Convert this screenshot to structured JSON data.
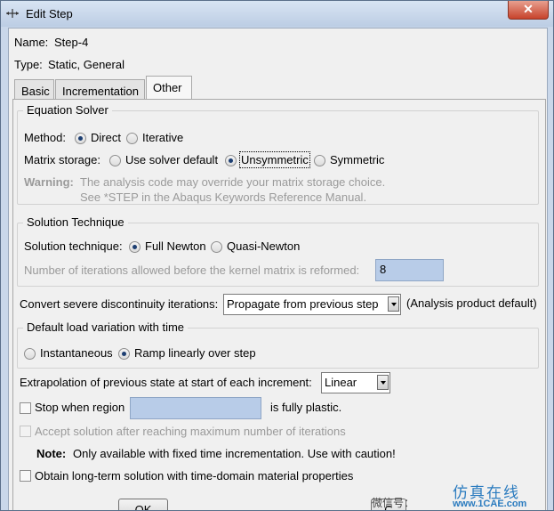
{
  "window": {
    "title": "Edit Step",
    "close_label": "✕"
  },
  "header": {
    "name_label": "Name:",
    "name_value": "Step-4",
    "type_label": "Type:",
    "type_value": "Static, General"
  },
  "tabs": [
    {
      "label": "Basic"
    },
    {
      "label": "Incrementation"
    },
    {
      "label": "Other",
      "active": true
    }
  ],
  "equation_solver": {
    "title": "Equation Solver",
    "method_label": "Method:",
    "method_options": [
      "Direct",
      "Iterative"
    ],
    "method_selected": "Direct",
    "storage_label": "Matrix storage:",
    "storage_options": [
      "Use solver default",
      "Unsymmetric",
      "Symmetric"
    ],
    "storage_selected": "Unsymmetric",
    "warning_label": "Warning:",
    "warning_line1": "The analysis code may override your matrix storage choice.",
    "warning_line2": "See *STEP in the Abaqus Keywords Reference Manual."
  },
  "solution_technique": {
    "title": "Solution Technique",
    "label": "Solution technique:",
    "options": [
      "Full Newton",
      "Quasi-Newton"
    ],
    "selected": "Full Newton",
    "iterations_label": "Number of iterations allowed before the kernel matrix is reformed:",
    "iterations_value": "8"
  },
  "discontinuity": {
    "label": "Convert severe discontinuity iterations:",
    "selected": "Propagate from previous step",
    "note": "(Analysis product default)"
  },
  "load_variation": {
    "title": "Default load variation with time",
    "options": [
      "Instantaneous",
      "Ramp linearly over step"
    ],
    "selected": "Ramp linearly over step"
  },
  "extrapolation": {
    "label": "Extrapolation of previous state at start of each increment:",
    "selected": "Linear"
  },
  "stop_region": {
    "label": "Stop when region",
    "suffix": "is fully plastic.",
    "value": "",
    "checked": false
  },
  "accept_solution": {
    "label": "Accept solution after reaching maximum number of iterations",
    "checked": false,
    "enabled": false
  },
  "note": {
    "label": "Note:",
    "text": "Only available with fixed time incrementation. Use with caution!"
  },
  "long_term": {
    "label": "Obtain long-term solution with time-domain material properties",
    "checked": false
  },
  "buttons": {
    "ok": "OK",
    "cancel_partial": "C"
  },
  "watermark": {
    "cn": "仿真在线",
    "url": "www.1CAE.com",
    "wx": "微信号："
  },
  "colors": {
    "field_bg": "#b8cce8",
    "radio_dot": "#1d3f72",
    "titlebar": "#c9d7ea"
  }
}
